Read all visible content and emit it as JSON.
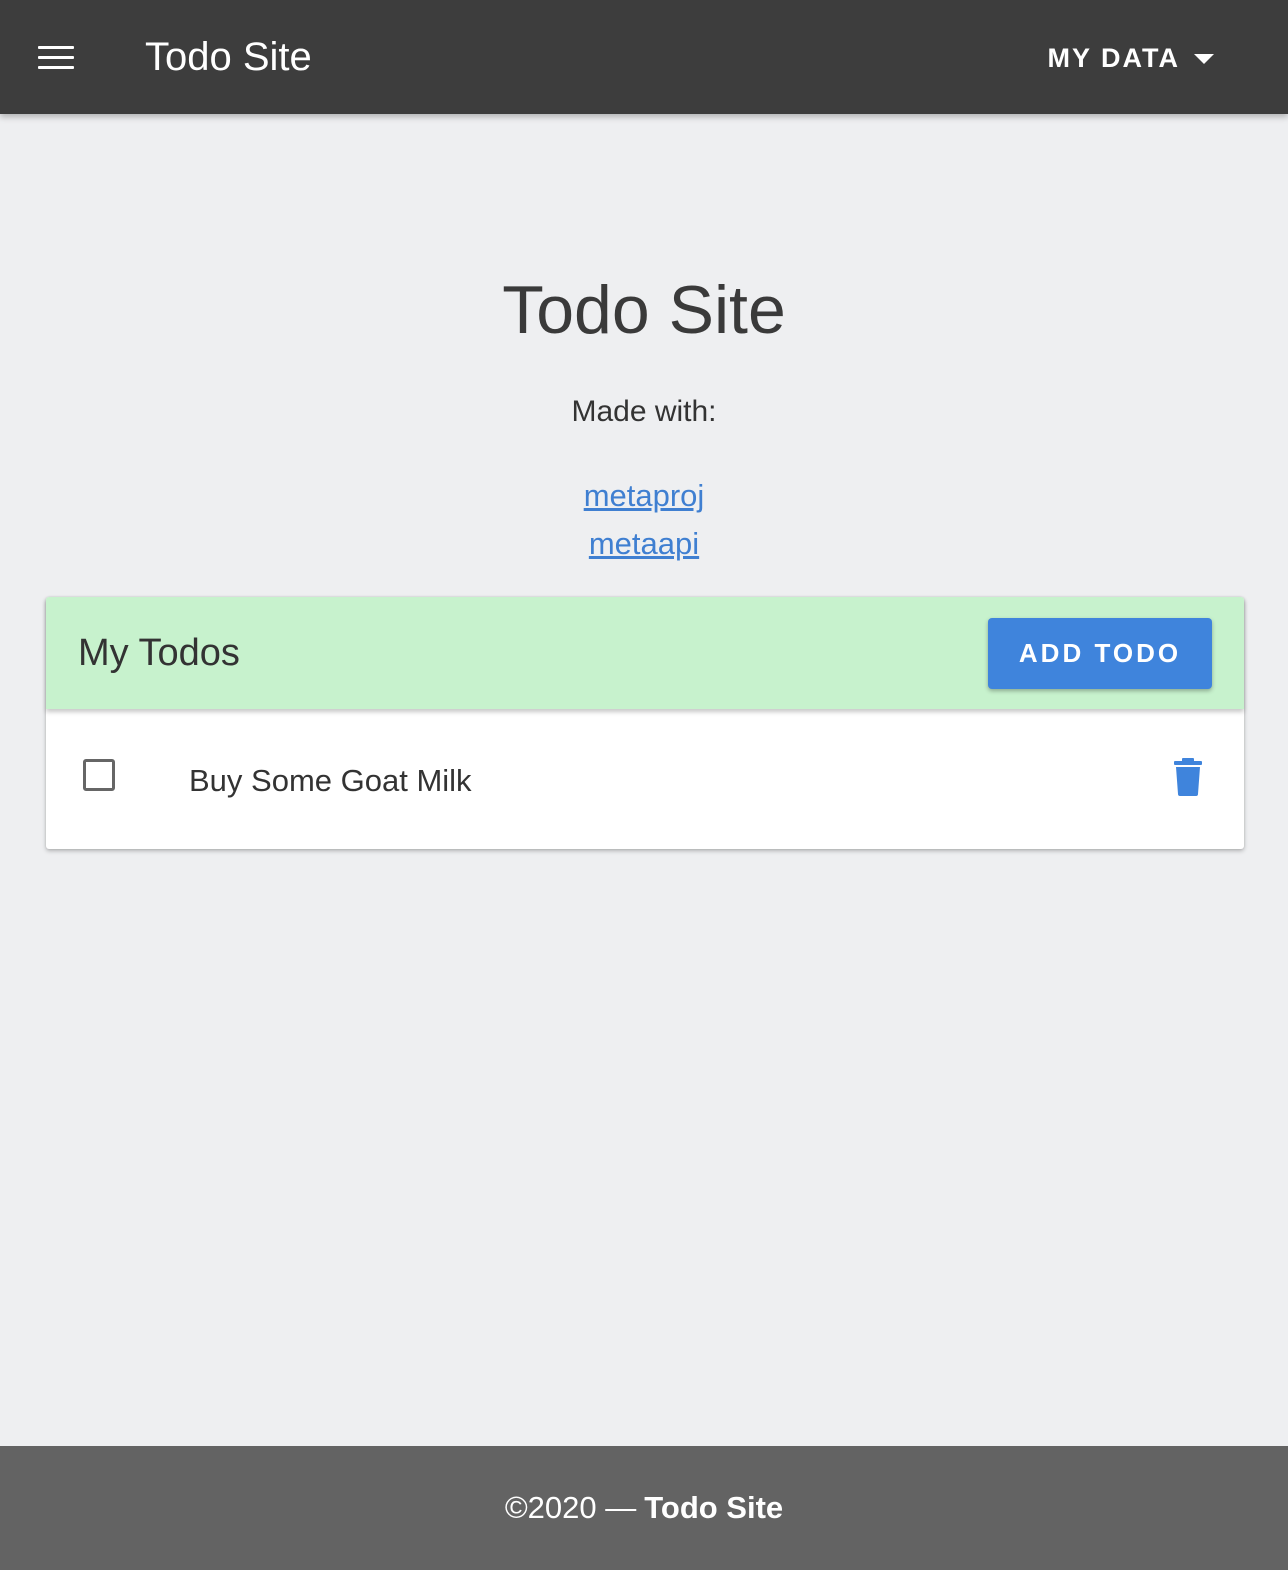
{
  "appbar": {
    "title": "Todo Site",
    "menu_icon": "hamburger-menu-icon",
    "dropdown_label": "MY DATA",
    "dropdown_icon": "caret-down-icon",
    "background": "#3d3d3d"
  },
  "hero": {
    "title": "Todo Site",
    "made_with": "Made with:",
    "links": [
      {
        "label": "metaproj"
      },
      {
        "label": "metaapi"
      }
    ],
    "link_color": "#3f7fd1"
  },
  "todos_card": {
    "title": "My Todos",
    "add_button": "ADD TODO",
    "header_color": "#c7f2cd",
    "button_color": "#3f84dc",
    "items": [
      {
        "text": "Buy Some Goat Milk",
        "checked": false,
        "delete_icon": "trash-icon"
      }
    ]
  },
  "footer": {
    "copyright": "©2020 —",
    "site_name": "Todo Site",
    "background": "#636363"
  }
}
